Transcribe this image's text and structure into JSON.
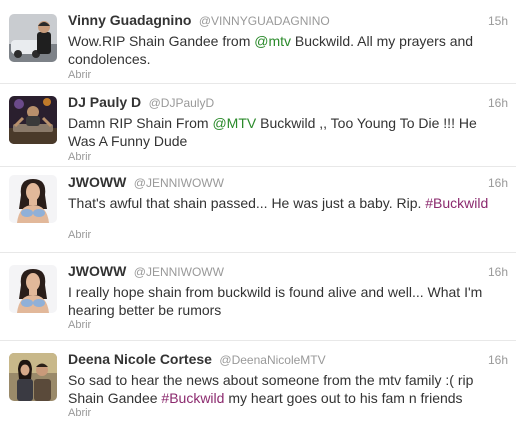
{
  "colors": {
    "mention": "#2a8a2a",
    "hashtag": "#8b2a6e",
    "meta": "#999999",
    "text": "#333333",
    "divider": "#e8e8e8"
  },
  "tweets": [
    {
      "fullname": "Vinny Guadagnino",
      "username": "@VINNYGUADAGNINO",
      "time": "15h",
      "text_parts": [
        "Wow.RIP Shain Gandee from ",
        "@mtv",
        " Buckwild. All my prayers and condolences."
      ],
      "action": "Abrir",
      "avatar_icon": "avatar-photo-man-with-car"
    },
    {
      "fullname": "DJ Pauly D",
      "username": "@DJPaulyD",
      "time": "16h",
      "text_parts": [
        "Damn RIP Shain From ",
        "@MTV",
        " Buckwild ,, Too Young To Die !!! He Was A Funny Dude"
      ],
      "action": "Abrir",
      "avatar_icon": "avatar-photo-dj-at-decks"
    },
    {
      "fullname": "JWOWW",
      "username": "@JENNIWOWW",
      "time": "16h",
      "text_parts": [
        "That's awful that shain passed... He was just a baby. Rip. ",
        "#Buckwild"
      ],
      "action": "Abrir",
      "avatar_icon": "avatar-photo-woman"
    },
    {
      "fullname": "JWOWW",
      "username": "@JENNIWOWW",
      "time": "16h",
      "text_parts": [
        "I really hope shain from buckwild is found alive and well... What I'm hearing better be rumors"
      ],
      "action": "Abrir",
      "avatar_icon": "avatar-photo-woman"
    },
    {
      "fullname": "Deena Nicole Cortese",
      "username": "@DeenaNicoleMTV",
      "time": "16h",
      "text_parts": [
        "So sad to hear the news about someone from the mtv family :( rip Shain Gandee ",
        "#Buckwild",
        " my heart goes out to his fam n friends"
      ],
      "action": "Abrir",
      "avatar_icon": "avatar-photo-couple"
    }
  ]
}
